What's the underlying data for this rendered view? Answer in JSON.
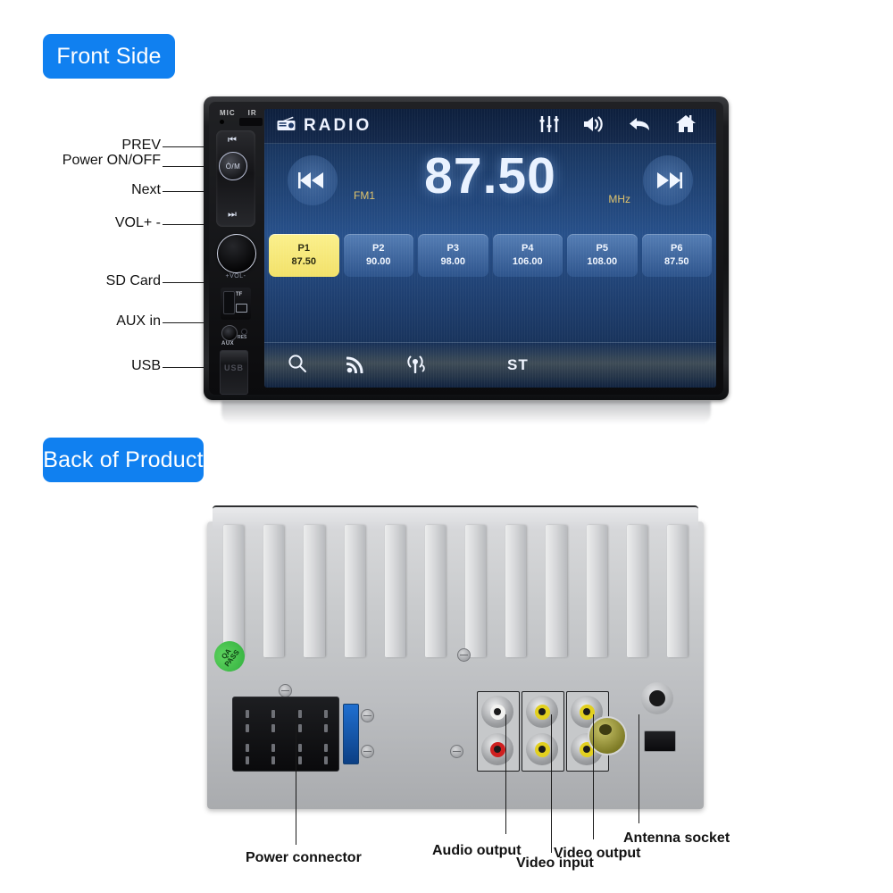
{
  "sections": {
    "front_badge": "Front Side",
    "back_badge": "Back of Product"
  },
  "front": {
    "bezel_labels": {
      "mic": "MIC",
      "ir": "IR"
    },
    "controls": {
      "prev_glyph": "⏮",
      "next_glyph": "⏭",
      "power_label": "Ò/M",
      "vol_mark": "+VOL-",
      "tf_label": "TF",
      "res_label": "RES",
      "aux_label": "AUX",
      "usb_label": "USB"
    },
    "callouts": [
      {
        "label": "PREV"
      },
      {
        "label": "Power ON/OFF"
      },
      {
        "label": "Next"
      },
      {
        "label": "VOL+ -"
      },
      {
        "label": "SD Card"
      },
      {
        "label": "AUX in"
      },
      {
        "label": "USB"
      }
    ],
    "screen": {
      "title": "RADIO",
      "top_icons": [
        "equalizer-icon",
        "volume-icon",
        "back-icon",
        "home-icon"
      ],
      "band": "FM1",
      "frequency": "87.50",
      "unit": "MHz",
      "presets": [
        {
          "name": "P1",
          "freq": "87.50",
          "active": true
        },
        {
          "name": "P2",
          "freq": "90.00",
          "active": false
        },
        {
          "name": "P3",
          "freq": "98.00",
          "active": false
        },
        {
          "name": "P4",
          "freq": "106.00",
          "active": false
        },
        {
          "name": "P5",
          "freq": "108.00",
          "active": false
        },
        {
          "name": "P6",
          "freq": "87.50",
          "active": false
        }
      ],
      "bottom_icons": [
        "search-icon",
        "rss-signal-icon",
        "broadcast-antenna-icon"
      ],
      "stereo_label": "ST"
    }
  },
  "back": {
    "qa_sticker": {
      "line1": "QA",
      "line2": "PASS"
    },
    "callouts": [
      {
        "label": "Power connector"
      },
      {
        "label": "Audio output"
      },
      {
        "label": "Video input"
      },
      {
        "label": "Video output"
      },
      {
        "label": "Antenna socket"
      }
    ]
  },
  "colors": {
    "badge_blue": "#1080f0",
    "preset_active": "#f5e877",
    "accent_gold": "#e0c36a",
    "qa_green": "#3fc14c"
  }
}
